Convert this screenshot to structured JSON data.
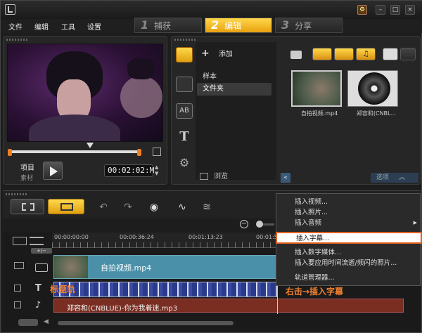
{
  "menu": [
    "文件",
    "编辑",
    "工具",
    "设置"
  ],
  "steps": [
    {
      "num": "1",
      "label": "捕获"
    },
    {
      "num": "2",
      "label": "编辑"
    },
    {
      "num": "3",
      "label": "分享"
    }
  ],
  "preview": {
    "project_label": "项目",
    "clip_label": "素材",
    "timecode": "00:02:02",
    "timecode_suffix": "M"
  },
  "library": {
    "add_label": "添加",
    "folders": [
      "样本",
      "文件夹"
    ],
    "browse_label": "浏览",
    "options_label": "选项",
    "thumbs": [
      {
        "label": "自拍视频.mp4"
      },
      {
        "label": "郑容和(CNBL..."
      }
    ]
  },
  "timeline": {
    "ruler": [
      "00:00:00:00",
      "00:00:36:24",
      "00:01:13:23",
      "00:01:5"
    ],
    "video_clip": "自拍视频.mp4",
    "audio_clip": "郑容和(CNBLUE)-你为我着迷.mp3",
    "annotation_title_track": "标题轨",
    "annotation_right_click": "右击→插入字幕"
  },
  "context_menu": [
    {
      "label": "插入视频..."
    },
    {
      "label": "插入照片..."
    },
    {
      "label": "插入音频",
      "submenu": true
    },
    {
      "label": "插入字幕..."
    },
    {
      "label": "插入数字媒体..."
    },
    {
      "label": "插入要应用时间流逝/频闪的照片..."
    },
    {
      "label": "轨道管理器..."
    }
  ],
  "colors": {
    "accent": "#f0b020",
    "highlight_border": "#e06020",
    "annotation": "#f08030",
    "video_track": "#4a90a8",
    "audio_track": "#7a2e22"
  }
}
